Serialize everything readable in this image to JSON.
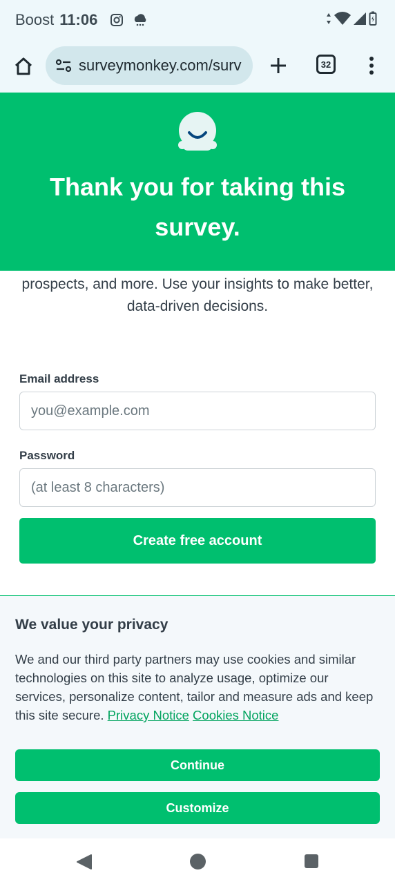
{
  "status_bar": {
    "carrier": "Boost",
    "time": "11:06",
    "icons_left": [
      "instagram-icon",
      "cloud-icon"
    ],
    "icons_right": [
      "data-arrows-icon",
      "wifi-icon",
      "signal-icon",
      "battery-icon"
    ]
  },
  "browser": {
    "url": "surveymonkey.com/surv",
    "tab_count": "32",
    "icons": [
      "home-icon",
      "site-settings-icon",
      "new-tab-icon",
      "tabs-icon",
      "overflow-menu-icon"
    ]
  },
  "hero": {
    "title": "Thank you for taking this survey.",
    "background": "#00bf6f"
  },
  "intro": {
    "text": "prospects, and more. Use your insights to make better, data-driven decisions."
  },
  "form": {
    "email_label": "Email address",
    "email_placeholder": "you@example.com",
    "password_label": "Password",
    "password_placeholder": "(at least 8 characters)",
    "submit_label": "Create free account"
  },
  "privacy": {
    "title": "We value your privacy",
    "body": "We and our third party partners may use cookies and similar technologies on this site to analyze usage, optimize our services, personalize content, tailor and measure ads and keep this site secure.",
    "privacy_link": "Privacy Notice",
    "cookies_link": "Cookies Notice",
    "continue_label": "Continue",
    "customize_label": "Customize"
  },
  "colors": {
    "accent": "#00bf6f",
    "link": "#00a35e",
    "text": "#333e48"
  }
}
